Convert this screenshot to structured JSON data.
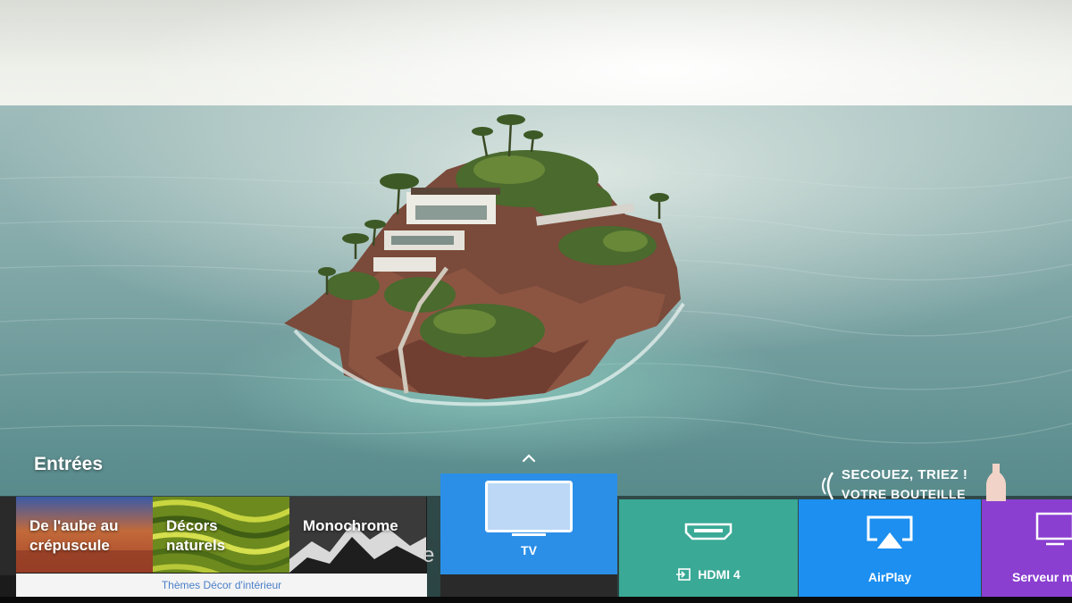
{
  "section": {
    "title": "Entrées"
  },
  "ambient": {
    "tiles": [
      {
        "label_line1": "De l'aube au",
        "label_line2": "crépuscule"
      },
      {
        "label_line1": "Décors",
        "label_line2": "naturels"
      },
      {
        "label_line1": "Monochrome",
        "label_line2": ""
      }
    ],
    "subtitle": "Thèmes Décor d'intérieur",
    "peek_text": "e"
  },
  "sources": [
    {
      "label": "TV",
      "icon": "tv-icon",
      "color": "#2b8fe8",
      "state": "focused"
    },
    {
      "label": "HDMI 4",
      "icon": "hdmi-icon",
      "color": "#3aa996"
    },
    {
      "label": "AirPlay",
      "icon": "airplay-icon",
      "color": "#1c8ff0"
    },
    {
      "label": "Serveur m",
      "icon": "media-server-icon",
      "color": "#8a3fd0"
    }
  ],
  "promo": {
    "line1": "SECOUEZ, TRIEZ !",
    "line2": "VOTRE BOUTEILLE"
  }
}
